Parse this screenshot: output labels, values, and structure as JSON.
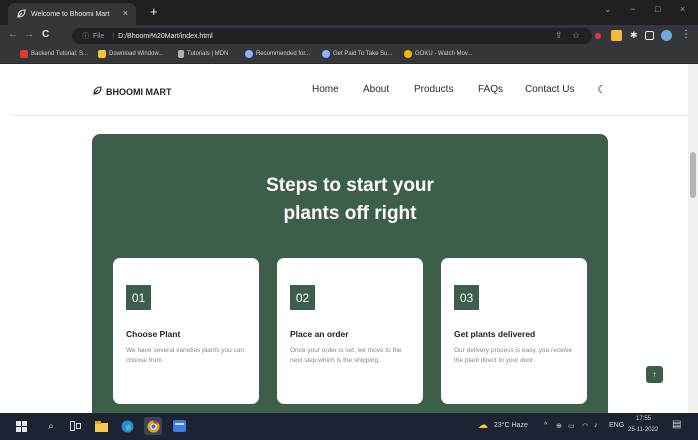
{
  "browser": {
    "tab_title": "Welcome to Bhoomi Mart",
    "tab_close": "×",
    "new_tab": "+",
    "window_controls": {
      "chevron": "⌄",
      "minimize": "−",
      "maximize": "□",
      "close": "×"
    },
    "nav": {
      "back": "←",
      "forward": "→",
      "reload": "C"
    },
    "address": {
      "scheme_label": "File",
      "path": "D:/Bhoomi%20Mart/index.html"
    },
    "bookmarks": [
      {
        "label": "Backend Tutorial: S...",
        "icon": "youtube-icon",
        "color": "#e53935"
      },
      {
        "label": "Download Window...",
        "icon": "windows-icon",
        "color": "#f4c430"
      },
      {
        "label": "Tutorials | MDN",
        "icon": "mdn-icon",
        "color": "#b0b0b0"
      },
      {
        "label": "Recommended for...",
        "icon": "globe-icon",
        "color": "#8ab4f8"
      },
      {
        "label": "Get Paid To Take Su...",
        "icon": "globe-icon",
        "color": "#8ab4f8"
      },
      {
        "label": "GOKU - Watch Mov...",
        "icon": "goku-icon",
        "color": "#f7b500"
      }
    ]
  },
  "site": {
    "brand": "BHOOMI MART",
    "nav_links": [
      "Home",
      "About",
      "Products",
      "FAQs",
      "Contact Us"
    ],
    "section": {
      "heading_line1": "Steps to start your",
      "heading_line2": "plants off right",
      "cards": [
        {
          "number": "01",
          "title": "Choose Plant",
          "description": "We have several varieties plants you can choose from."
        },
        {
          "number": "02",
          "title": "Place an order",
          "description": "Once your order is set, we move to the next step which is the shipping."
        },
        {
          "number": "03",
          "title": "Get plants delivered",
          "description": "Our delivery process is easy, you receive the plant direct to your door."
        }
      ]
    },
    "back_to_top": "↑",
    "accent_color": "#3d5e4b"
  },
  "taskbar": {
    "weather": "23°C  Haze",
    "language": "ENG",
    "time": "17:55",
    "date": "25-11-2022"
  }
}
